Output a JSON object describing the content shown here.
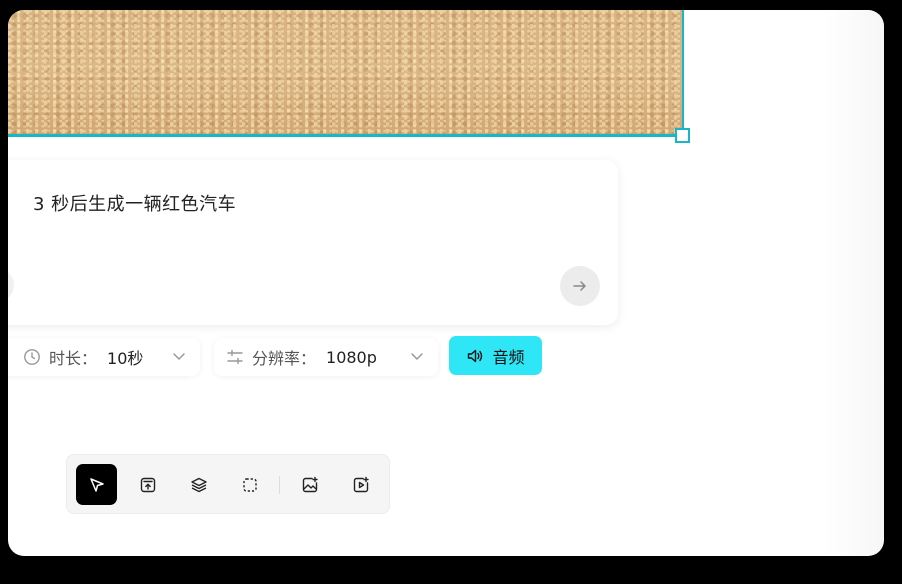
{
  "prompt": {
    "text": "3 秒后生成一辆红色汽车"
  },
  "options": {
    "duration_label": "时长：",
    "duration_value": "10秒",
    "resolution_label": "分辨率：",
    "resolution_value": "1080p",
    "audio_label": "音频"
  },
  "toolbar": {
    "tools": [
      {
        "icon": "cursor-icon",
        "active": true
      },
      {
        "icon": "upload-icon",
        "active": false
      },
      {
        "icon": "layers-icon",
        "active": false
      },
      {
        "icon": "selection-icon",
        "active": false
      },
      {
        "icon": "image-generate-icon",
        "active": false
      },
      {
        "icon": "video-generate-icon",
        "active": false
      }
    ]
  },
  "colors": {
    "accent": "#17b7c9",
    "audio_button": "#2ee6f5",
    "active_tool": "#000000"
  }
}
